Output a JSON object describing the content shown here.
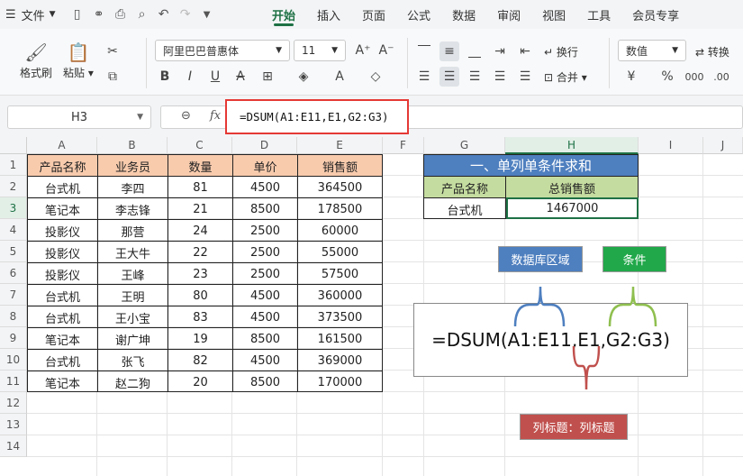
{
  "menubar": {
    "file_label": "文件"
  },
  "tabs": [
    "开始",
    "插入",
    "页面",
    "公式",
    "数据",
    "审阅",
    "视图",
    "工具",
    "会员专享"
  ],
  "ribbon": {
    "format_painter": "格式刷",
    "paste": "粘贴",
    "font_name": "阿里巴巴普惠体",
    "font_size": "11",
    "wrap": "换行",
    "merge": "合并",
    "number_format": "数值",
    "convert": "转换"
  },
  "namebox": "H3",
  "formula": "=DSUM(A1:E11,E1,G2:G3)",
  "columns": [
    "A",
    "B",
    "C",
    "D",
    "E",
    "F",
    "G",
    "H",
    "I",
    "J"
  ],
  "rows": [
    "1",
    "2",
    "3",
    "4",
    "5",
    "6",
    "7",
    "8",
    "9",
    "10",
    "11",
    "12",
    "13",
    "14"
  ],
  "table": {
    "headers": [
      "产品名称",
      "业务员",
      "数量",
      "单价",
      "销售额"
    ],
    "rows": [
      [
        "台式机",
        "李四",
        "81",
        "4500",
        "364500"
      ],
      [
        "笔记本",
        "李志锋",
        "21",
        "8500",
        "178500"
      ],
      [
        "投影仪",
        "那营",
        "24",
        "2500",
        "60000"
      ],
      [
        "投影仪",
        "王大牛",
        "22",
        "2500",
        "55000"
      ],
      [
        "投影仪",
        "王峰",
        "23",
        "2500",
        "57500"
      ],
      [
        "台式机",
        "王明",
        "80",
        "4500",
        "360000"
      ],
      [
        "台式机",
        "王小宝",
        "83",
        "4500",
        "373500"
      ],
      [
        "笔记本",
        "谢广坤",
        "19",
        "8500",
        "161500"
      ],
      [
        "台式机",
        "张飞",
        "82",
        "4500",
        "369000"
      ],
      [
        "笔记本",
        "赵二狗",
        "20",
        "8500",
        "170000"
      ]
    ]
  },
  "criteria": {
    "title": "一、单列单条件求和",
    "h1": "产品名称",
    "h2": "总销售额",
    "v1": "台式机",
    "v2": "1467000"
  },
  "annotation": {
    "database": "数据库区域",
    "condition": "条件",
    "formula": "=DSUM(A1:E11,E1,G2:G3)",
    "field": "列标题：列标题"
  },
  "colors": {
    "accent": "#1e7145",
    "header_fill": "#f8cbad",
    "title_fill": "#4e7fbf",
    "criteria_fill": "#c5dca0",
    "red_box": "#e53935"
  }
}
